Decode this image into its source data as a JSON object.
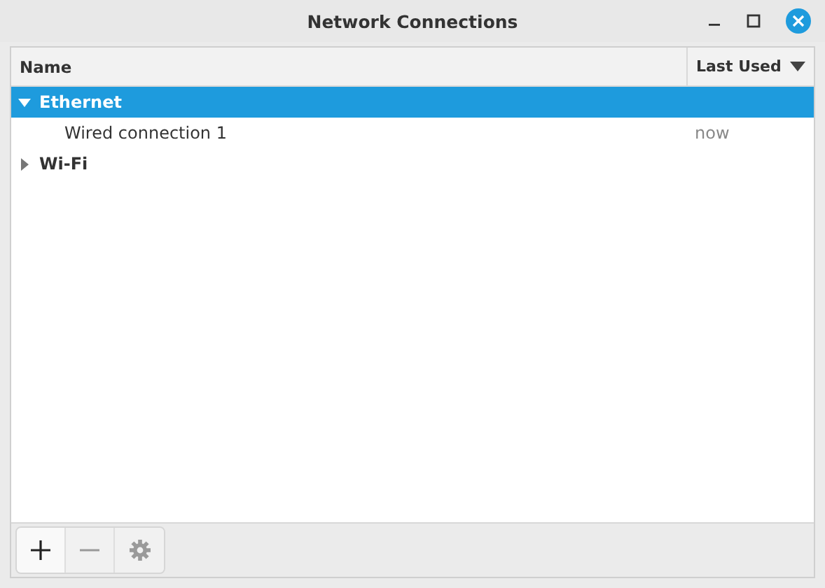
{
  "window": {
    "title": "Network Connections"
  },
  "columns": [
    {
      "label": "Name",
      "sorted": false
    },
    {
      "label": "Last Used",
      "sorted": true
    }
  ],
  "connections": [
    {
      "name": "Ethernet",
      "expanded": true,
      "selected": true,
      "children": [
        {
          "name": "Wired connection 1",
          "last_used": "now",
          "selected": false
        }
      ]
    },
    {
      "name": "Wi-Fi",
      "expanded": false,
      "selected": false
    }
  ],
  "toolbar": [
    {
      "kind": "add",
      "disabled": false
    },
    {
      "kind": "remove",
      "disabled": true
    },
    {
      "kind": "settings",
      "disabled": true
    }
  ]
}
